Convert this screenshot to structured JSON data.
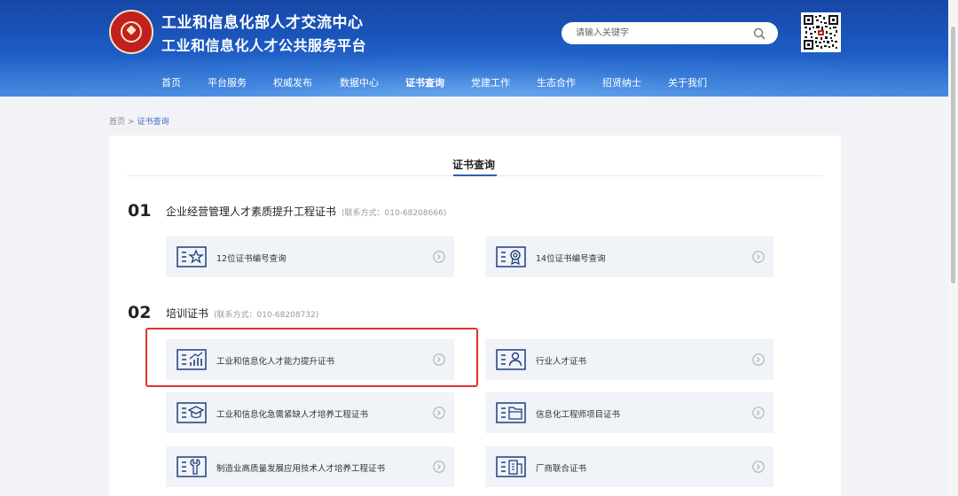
{
  "header": {
    "title_line1": "工业和信息化部人才交流中心",
    "title_line2": "工业和信息化人才公共服务平台",
    "search_placeholder": "请输入关键字",
    "brand_color": "#1d5cc4"
  },
  "nav": {
    "items": [
      {
        "label": "首页"
      },
      {
        "label": "平台服务"
      },
      {
        "label": "权威发布"
      },
      {
        "label": "数据中心"
      },
      {
        "label": "证书查询",
        "active": true
      },
      {
        "label": "党建工作"
      },
      {
        "label": "生态合作"
      },
      {
        "label": "招贤纳士"
      },
      {
        "label": "关于我们"
      }
    ]
  },
  "breadcrumb": {
    "home": "首页",
    "separator": ">",
    "current": "证书查询"
  },
  "panel": {
    "title": "证书查询"
  },
  "sections": [
    {
      "number": "01",
      "title": "企业经营管理人才素质提升工程证书",
      "contact": "(联系方式：010-68208666)",
      "cards": [
        {
          "label": "12位证书编号查询",
          "icon": "list-star-icon"
        },
        {
          "label": "14位证书编号查询",
          "icon": "list-award-icon"
        }
      ]
    },
    {
      "number": "02",
      "title": "培训证书",
      "contact": "(联系方式：010-68208732)",
      "cards": [
        {
          "label": "工业和信息化人才能力提升证书",
          "icon": "list-chart-icon"
        },
        {
          "label": "行业人才证书",
          "icon": "list-person-icon"
        },
        {
          "label": "工业和信息化急需紧缺人才培养工程证书",
          "icon": "list-graduation-cap-icon"
        },
        {
          "label": "信息化工程师项目证书",
          "icon": "list-folder-icon"
        },
        {
          "label": "制造业高质量发展应用技术人才培养工程证书",
          "icon": "list-wrench-icon"
        },
        {
          "label": "厂商联合证书",
          "icon": "list-building-icon"
        }
      ]
    }
  ],
  "colors": {
    "accent": "#2a5fb8",
    "highlight_border": "#e0322b",
    "card_bg": "#f0f3f8",
    "icon_stroke": "#1f3f7a"
  }
}
